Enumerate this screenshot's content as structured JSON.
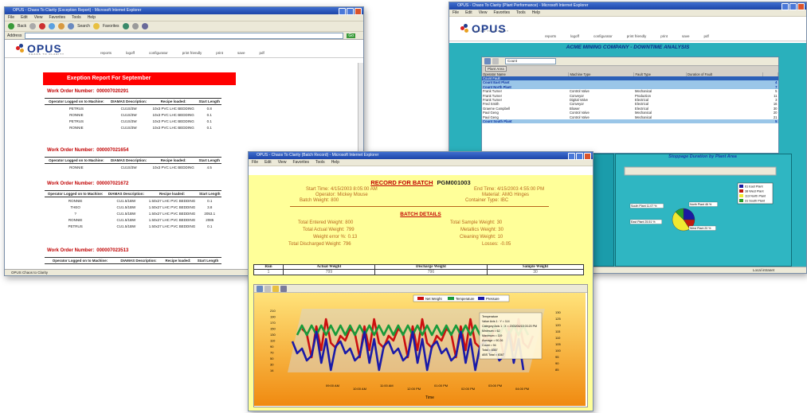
{
  "common": {
    "menu": [
      "File",
      "Edit",
      "View",
      "Favorites",
      "Tools",
      "Help"
    ],
    "nav_links": [
      "reports",
      "logoff",
      "configurator",
      "print friendly",
      "print",
      "save",
      "pdf"
    ],
    "logo_text": "OPUS",
    "logo_tagline": "CHAOS TO CLARITY"
  },
  "win1": {
    "title": "OPUS - Chaos To Clarity (Exception Report) - Microsoft Internet Explorer",
    "toolbar": [
      "Back",
      "Search",
      "Favorites"
    ],
    "address_label": "Address",
    "go_label": "Go",
    "banner": "Exeption Report For  September",
    "wo_label": "Work Order Number:",
    "headers": [
      "Operator Logged on to Machine:",
      "DIAMAS Description:",
      "Recipe loaded:",
      "Start Length"
    ],
    "orders": [
      {
        "number": "000007020291",
        "rows": [
          [
            "PETRUS",
            "CU1S/3W",
            "10x3 PVC LHC BEDDING",
            "0.8"
          ],
          [
            "RONNIE",
            "CU1S/3W",
            "10x3 PVC LHC BEDDING",
            "0.1"
          ],
          [
            "PETRUS",
            "CU1S/3W",
            "10x3 PVC LHC BEDDING",
            "0.1"
          ],
          [
            "RONNIE",
            "CU1S/3W",
            "10x3 PVC LHC BEDDING",
            "0.1"
          ]
        ]
      },
      {
        "number": "000007021654",
        "rows": [
          [
            "RONNIE",
            "CU1S/3W",
            "10x3 PVC LHC BEDDING",
            "4.5"
          ]
        ]
      },
      {
        "number": "000007021672",
        "rows": [
          [
            "RONNIE",
            "CU1.5/1BW",
            "1.50x27 LHC PVC BEDDING",
            "0.1"
          ],
          [
            "THEO",
            "CU1.5/1BW",
            "1.50x27 LHC PVC BEDDING",
            "3.8"
          ],
          [
            "?",
            "CU1.5/1BW",
            "1.50x27 LHC PVC BEDDING",
            "2053.1"
          ],
          [
            "RONNIE",
            "CU1.5/1BW",
            "1.50x27 LHC PVC BEDDING",
            "2085"
          ],
          [
            "PETRUS",
            "CU1.5/1BW",
            "1.50x27 LHC PVC BEDDING",
            "0.1"
          ]
        ]
      },
      {
        "number": "000007023513",
        "rows": []
      }
    ],
    "status": "OPUS Chaos to Clarity"
  },
  "win2": {
    "title": "OPUS - Chaos To Clarity (Plant Performance) - Microsoft Internet Explorer",
    "heading": "ACME MINING COMPANY - DOWNTIME ANALYSIS",
    "dropdown_value": "Count",
    "plant_area_tab": "Plant Area",
    "columns": [
      "Operator Name",
      "Machine Type",
      "Fault Type",
      "Duration of Fault"
    ],
    "rows": [
      {
        "type": "hl",
        "cells": [
          "Count Fault",
          "",
          "",
          "",
          ""
        ]
      },
      {
        "type": "grp",
        "cells": [
          "Count East Plant",
          "",
          "",
          "",
          "4"
        ]
      },
      {
        "type": "grp",
        "cells": [
          "Count North Plant",
          "",
          "",
          "",
          "7"
        ]
      },
      {
        "type": "row",
        "cells": [
          "Frank Turner",
          "Control Valve",
          "Mechanical",
          "",
          "5"
        ]
      },
      {
        "type": "row",
        "cells": [
          "Frank Turner",
          "Conveyor",
          "Production",
          "",
          "11"
        ]
      },
      {
        "type": "row",
        "cells": [
          "Frank Turner",
          "Digital Valve",
          "Electrical",
          "",
          "3"
        ]
      },
      {
        "type": "row",
        "cells": [
          "Fred Smith",
          "Conveyor",
          "Electrical",
          "",
          "16"
        ]
      },
      {
        "type": "row",
        "cells": [
          "Graeme Campbell",
          "Blower",
          "Electrical",
          "",
          "30"
        ]
      },
      {
        "type": "row",
        "cells": [
          "Paul Geng",
          "Control Valve",
          "Mechanical",
          "",
          "20"
        ]
      },
      {
        "type": "row",
        "cells": [
          "Paul Geng",
          "Control Valve",
          "Mechanical",
          "",
          "21"
        ]
      },
      {
        "type": "grp",
        "cells": [
          "Count South Plant",
          "",
          "",
          "",
          "5"
        ]
      }
    ],
    "stoppage_title": "Stoppage Duration by Plant Area",
    "status": "Local intranet",
    "chart_data": {
      "type": "pie",
      "title": "Stoppage Duration by Plant Area",
      "legend_position": "top-right",
      "series": [
        {
          "name": "East Plant",
          "value": 61
        },
        {
          "name": "West Plant",
          "value": 38
        },
        {
          "name": "North Plant",
          "value": 113
        },
        {
          "name": "South Plant",
          "value": 31
        }
      ],
      "legend": [
        "61 East Plant",
        "38 West Plant",
        "113 North Plant",
        "31 South Plant"
      ],
      "slice_labels": [
        "North Plant 46 %",
        "West Plant 20 %",
        "East Plant 25.51 %",
        "South Plant 11.07 %"
      ],
      "colors": [
        "#1a1aa0",
        "#c0180e",
        "#f0e830",
        "#2aa02a"
      ]
    }
  },
  "win3": {
    "title": "OPUS - Chaos To Clarity (Batch Record) - Microsoft Internet Explorer",
    "record_title": "RECORD FOR BATCH",
    "batch_id": "PGM001003",
    "left_info": [
      {
        "k": "Start Time:",
        "v": "4/15/2003 8:05:00 AM"
      },
      {
        "k": "Operator:",
        "v": "Mickey Mouse"
      },
      {
        "k": "Batch Weight:",
        "v": "800"
      }
    ],
    "right_info": [
      {
        "k": "End Time:",
        "v": "4/15/2003 4:55:00 PM"
      },
      {
        "k": "Material:",
        "v": "AMG Hinges"
      },
      {
        "k": "Container Type:",
        "v": "IBC"
      }
    ],
    "details_title": "BATCH DETAILS",
    "left_details": [
      {
        "k": "Total Entered Weight:",
        "v": "800"
      },
      {
        "k": "Total Actual Weight:",
        "v": "799"
      },
      {
        "k": "Weight error %:",
        "v": "0.13"
      },
      {
        "k": "Total Discharged Weight:",
        "v": "796"
      }
    ],
    "right_details": [
      {
        "k": "Total Sample Weight:",
        "v": "30"
      },
      {
        "k": "Metallics Weight:",
        "v": "30"
      },
      {
        "k": "Cleaning Weight:",
        "v": "10"
      },
      {
        "k": "Losses:",
        "v": "-0.05"
      }
    ],
    "summary_headers": [
      "Run",
      "Actual Weight",
      "Discharge Weight",
      "Sample Weight"
    ],
    "summary_row": [
      "1",
      "799",
      "796",
      "30"
    ],
    "chart_data": {
      "type": "line",
      "title": "",
      "series": [
        {
          "name": "Net Weight",
          "color": "#cc1010"
        },
        {
          "name": "Temperature",
          "color": "#1a9a3a"
        },
        {
          "name": "Pressure",
          "color": "#1a1aa8"
        }
      ],
      "x": [
        "09:00 AM",
        "10:00 AM",
        "11:00 AM",
        "12:00 PM",
        "01:00 PM",
        "02:00 PM",
        "03:00 PM",
        "04:00 PM"
      ],
      "xlabel": "Time",
      "yleft_ticks": [
        "210",
        "190",
        "170",
        "150",
        "130",
        "110",
        "90",
        "70",
        "50",
        "30",
        "14"
      ],
      "yright_ticks": [
        "130",
        "125",
        "120",
        "115",
        "110",
        "105",
        "100",
        "95",
        "90",
        "85"
      ],
      "tooltip": [
        "Temperature",
        "Value Axis 1 : Y = 114",
        "Category Axis 1 : X = 2003/04/15 03:20 PM",
        "Minimum = 62",
        "Maximum = 119",
        "Average = 90.26",
        "Count = 94",
        "Total = 8367",
        "ABS Total = 8367"
      ]
    }
  }
}
